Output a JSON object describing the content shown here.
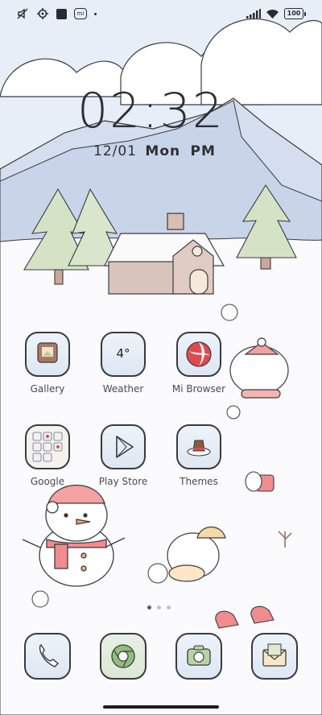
{
  "status_bar": {
    "battery": "100",
    "left_icons": [
      "mute-icon",
      "settings-gear-icon",
      "square-icon",
      "mi-icon",
      "dot-icon"
    ],
    "right_icons": [
      "signal-icon",
      "wifi-icon",
      "battery-icon"
    ]
  },
  "lock_clock": {
    "time": "02:32",
    "date": "12/01",
    "weekday": "Mon",
    "ampm": "PM"
  },
  "apps": [
    {
      "label": "Gallery",
      "icon": "gallery-icon"
    },
    {
      "label": "Weather",
      "icon": "weather-icon",
      "badge": "4°"
    },
    {
      "label": "Mi Browser",
      "icon": "browser-icon"
    },
    {
      "label": "Google",
      "icon": "google-folder-icon"
    },
    {
      "label": "Play Store",
      "icon": "play-store-icon"
    },
    {
      "label": "Themes",
      "icon": "themes-icon"
    }
  ],
  "dock": [
    {
      "icon": "phone-icon"
    },
    {
      "icon": "chrome-icon"
    },
    {
      "icon": "camera-icon"
    },
    {
      "icon": "messages-icon"
    }
  ],
  "pager": {
    "pages": 3,
    "active": 1
  },
  "colors": {
    "sky": "#e8eef8",
    "mountain": "#cfd9ea",
    "tree": "#d6e4c8",
    "roof": "#c9a79c",
    "accent_red": "#e3686b"
  }
}
